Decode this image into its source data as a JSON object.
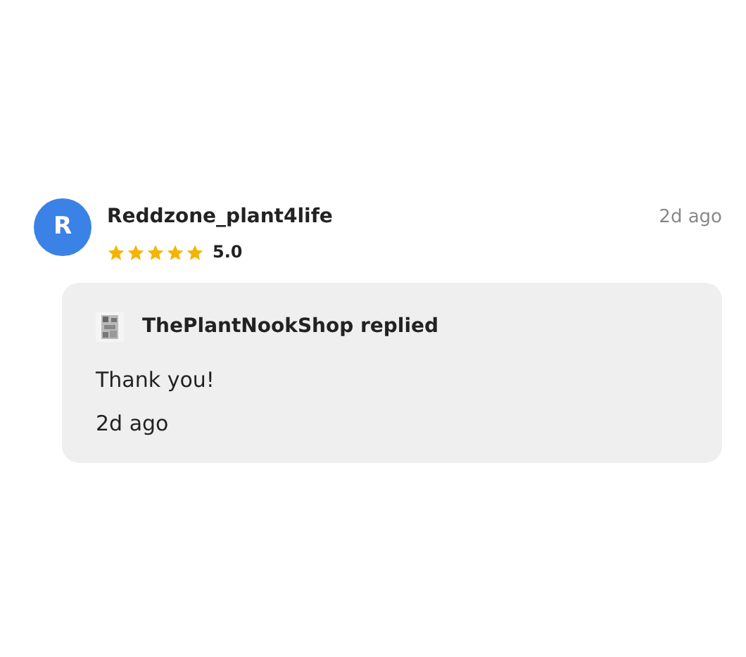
{
  "review": {
    "avatar_letter": "R",
    "author": "Reddzone_plant4life",
    "stars": 5,
    "rating": "5.0",
    "time": "2d ago",
    "reply": {
      "shop": "ThePlantNookShop replied",
      "text": "Thank you!",
      "time": "2d ago"
    }
  }
}
